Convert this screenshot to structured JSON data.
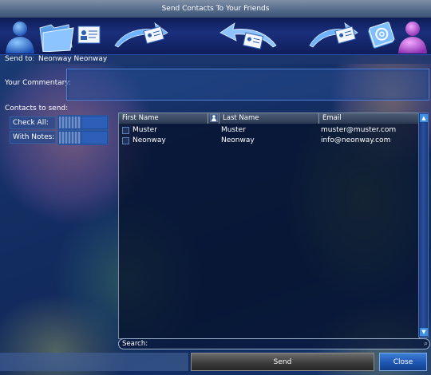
{
  "window": {
    "title": "Send Contacts To Your Friends"
  },
  "banner": {
    "icons": [
      "user-silhouette-icon",
      "folder-icon",
      "contact-card-icon",
      "send-card-arrow-icon",
      "receive-card-arrow-icon",
      "send-card-arrow-icon",
      "email-address-book-icon",
      "user-silhouette-icon"
    ]
  },
  "send_to": {
    "label": "Send to:",
    "value": "Neonway Neonway"
  },
  "commentary": {
    "label": "Your Commentary:",
    "value": ""
  },
  "contacts": {
    "label": "Contacts to send:",
    "check_all_label": "Check All:",
    "with_notes_label": "With Notes:"
  },
  "table": {
    "columns": [
      "First Name",
      "Last Name",
      "Email"
    ],
    "rows": [
      {
        "first": "Muster",
        "last": "Muster",
        "email": "muster@muster.com"
      },
      {
        "first": "Neonway",
        "last": "Neonway",
        "email": "info@neonway.com"
      }
    ]
  },
  "search": {
    "label": "Search:",
    "value": ""
  },
  "buttons": {
    "send": "Send",
    "close": "Close"
  }
}
